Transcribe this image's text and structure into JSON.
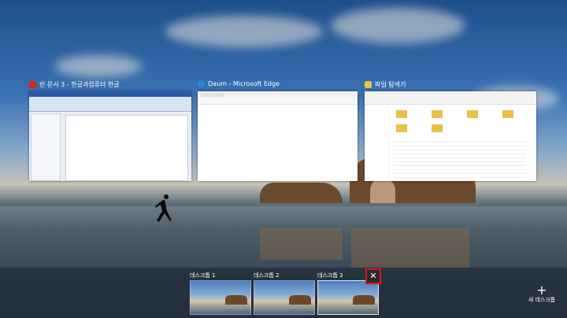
{
  "windows": [
    {
      "title": "빈 문서 3 - 한글과컴퓨터 한글",
      "icon": "hangul-icon"
    },
    {
      "title": "Daum - Microsoft Edge",
      "icon": "edge-icon"
    },
    {
      "title": "파일 탐색기",
      "icon": "folder-icon"
    }
  ],
  "desktops": [
    {
      "label": "데스크톱 1",
      "active": false
    },
    {
      "label": "데스크톱 2",
      "active": false
    },
    {
      "label": "데스크톱 3",
      "active": true
    }
  ],
  "close_label": "✕",
  "new_desktop": {
    "plus": "+",
    "label": "새 데스크톱"
  },
  "colors": {
    "accent_close_border": "#e0121a",
    "taskview_bar": "#232d37"
  }
}
